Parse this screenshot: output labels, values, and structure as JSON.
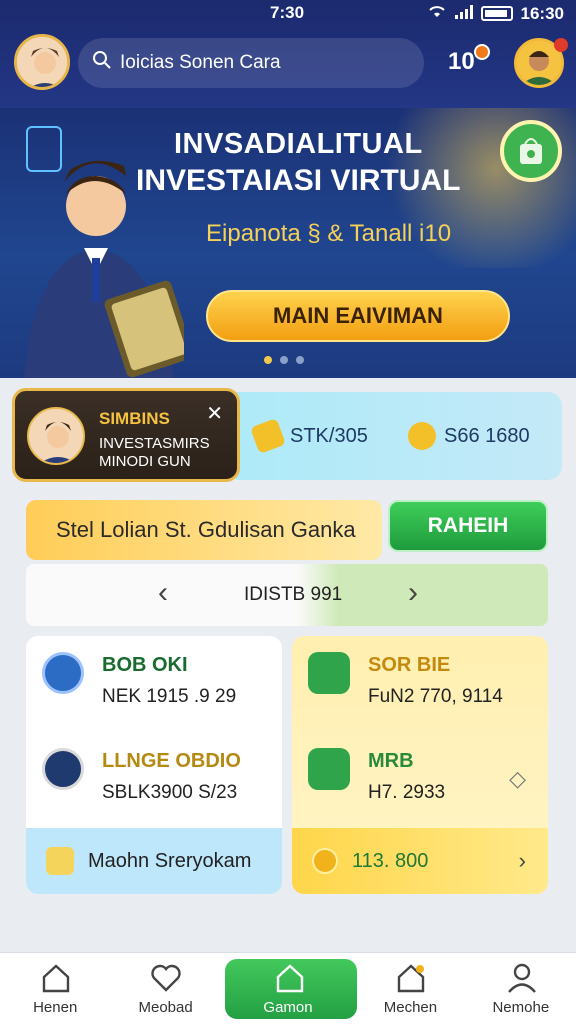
{
  "status": {
    "time": "7:30",
    "clock_right": "16:30"
  },
  "header": {
    "search_text": "Ioicias Sonen Cara",
    "notification_count": "10"
  },
  "banner": {
    "title_line1": "INVSADIALITUAL",
    "title_line2": "INVESTAIASI VIRTUAL",
    "subtitle": "Eipanota § & Tanall i10",
    "cta_label": "MAIN EAIVIMAN",
    "page_count": 3,
    "active_page": 0
  },
  "profile": {
    "title": "SIMBINS",
    "line1": "INVESTASMIRS",
    "line2": "MINODI GUN"
  },
  "stats": {
    "left": "STK/305",
    "right": "S66 1680"
  },
  "action": {
    "input_text": "Stel Lolian St. Gdulisan Ganka",
    "button_label": "RAHEIH"
  },
  "pager": {
    "label": "IDISTB 991"
  },
  "left_panel": {
    "items": [
      {
        "label": "BOB OKI",
        "value": "NEK 1915 .9 29",
        "color": "#1a6b2e"
      },
      {
        "label": "LLNGE OBDIO",
        "value": "SBLK3900 S/23",
        "color": "#b58a12"
      }
    ],
    "footer": "Maohn Sreryokam"
  },
  "right_panel": {
    "items": [
      {
        "label": "SOR BIE",
        "value": "FuN2 770, 9114",
        "color": "#c38a0e"
      },
      {
        "label": "MRB",
        "value": "H7. 2933",
        "color": "#2a8a3b"
      }
    ],
    "footer": "113. 800"
  },
  "nav": [
    {
      "label": "Henen",
      "icon": "home-icon",
      "active": false
    },
    {
      "label": "Meobad",
      "icon": "heart-icon",
      "active": false
    },
    {
      "label": "Gamon",
      "icon": "store-icon",
      "active": true
    },
    {
      "label": "Mechen",
      "icon": "chart-icon",
      "active": false
    },
    {
      "label": "Nemohe",
      "icon": "user-icon",
      "active": false
    }
  ],
  "colors": {
    "primary_dark": "#1c2a6e",
    "accent_gold": "#f6c341",
    "accent_green": "#2fb24a",
    "info_cyan": "#aeeaf9"
  }
}
